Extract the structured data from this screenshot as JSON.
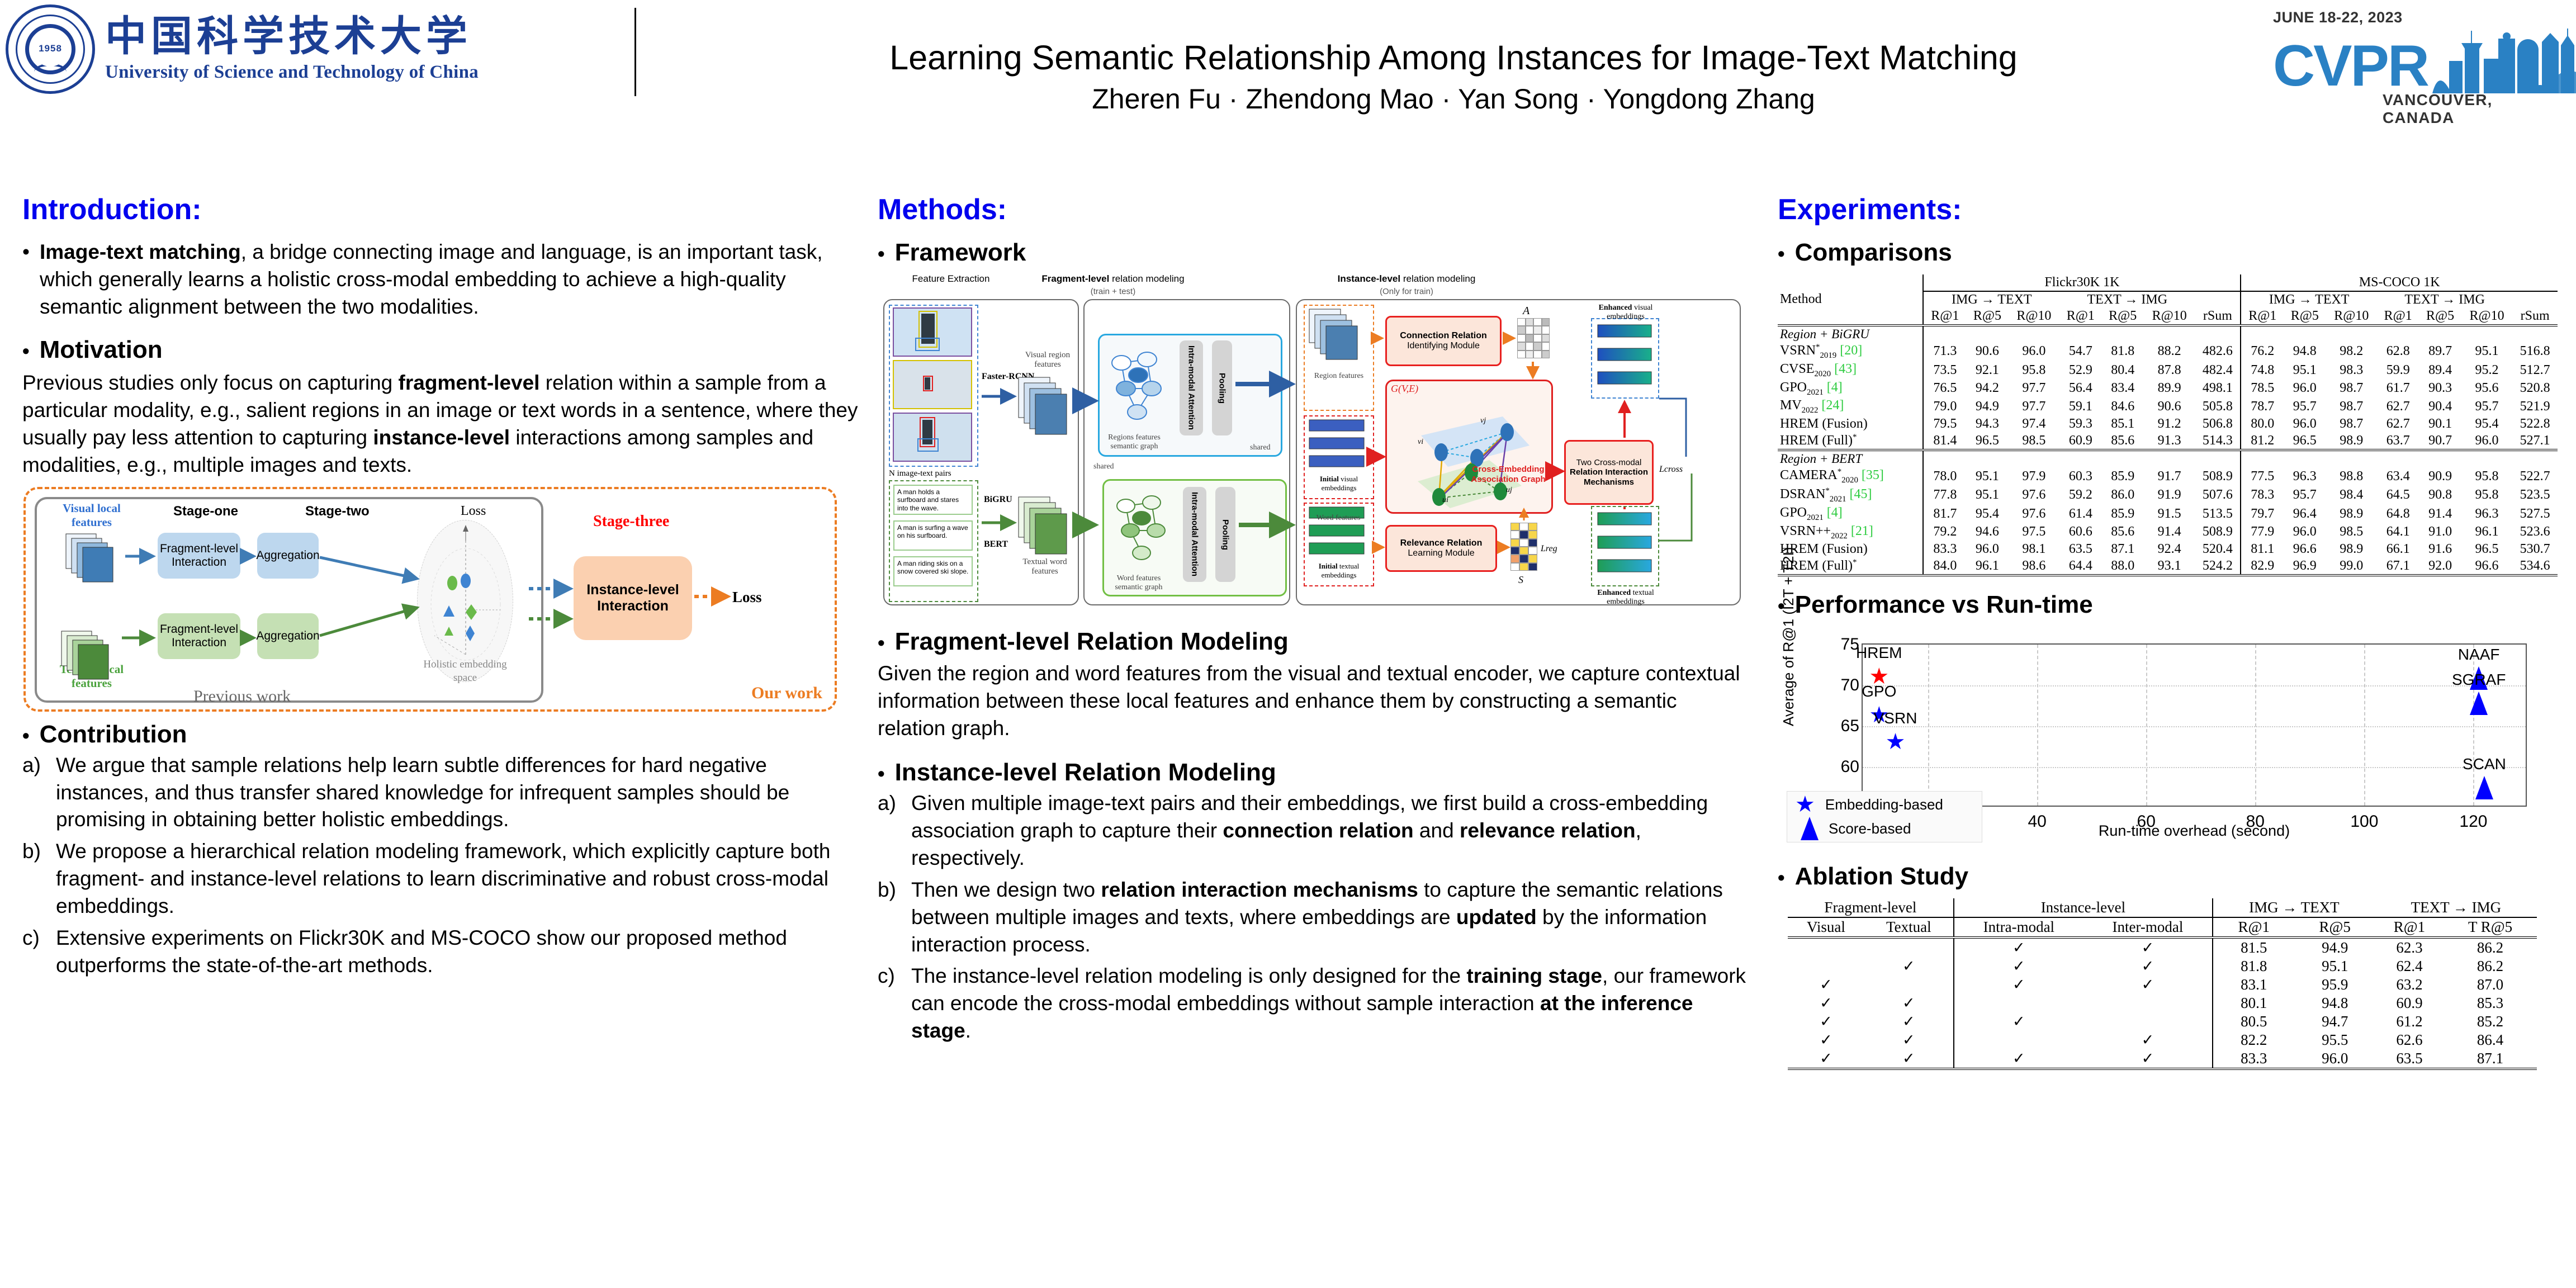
{
  "header": {
    "university_cn": "中国科学技术大学",
    "university_en": "University of Science and Technology of China",
    "seal_year": "1958",
    "paper_title": "Learning Semantic Relationship Among Instances for Image-Text Matching",
    "authors": "Zheren Fu · Zhendong Mao · Yan Song · Yongdong Zhang",
    "conference_date": "JUNE 18-22, 2023",
    "conference_name": "CVPR",
    "conference_location": "VANCOUVER, CANADA"
  },
  "intro": {
    "heading": "Introduction:",
    "b1_lead": "Image-text matching",
    "b1_rest": ", a bridge connecting image and language, is an important task, which generally learns a holistic cross-modal embedding to achieve a high-quality semantic alignment between the two modalities.",
    "motivation_heading": "Motivation",
    "motivation_p1": "Previous studies only focus on capturing ",
    "motivation_b1": "fragment-level",
    "motivation_p2": " relation within a sample from a particular modality, e.g., salient regions in an image or text words in a sentence, where they usually pay less attention to capturing ",
    "motivation_b2": "instance-level",
    "motivation_p3": " interactions among samples and modalities, e.g., multiple images and texts.",
    "figure": {
      "visual_local_features": "Visual local features",
      "textual_local_features": "Textual local features",
      "stage_one": "Stage-one",
      "stage_two": "Stage-two",
      "stage_three": "Stage-three",
      "loss": "Loss",
      "fragment_interaction": "Fragment-level Interaction",
      "aggregation": "Aggregation",
      "holistic_space": "Holistic embedding  space",
      "instance_interaction": "Instance-level Interaction",
      "loss_right": "Loss",
      "previous_work": "Previous work",
      "our_work": "Our work"
    },
    "contribution_heading": "Contribution",
    "contributions": [
      {
        "mark": "a)",
        "text": "We argue that sample relations help learn subtle differences for hard negative instances, and thus transfer shared knowledge for infrequent samples should be promising in obtaining better holistic embeddings."
      },
      {
        "mark": "b)",
        "text": "We propose a hierarchical relation modeling framework, which explicitly capture both fragment- and instance-level relations to learn discriminative and robust cross-modal embeddings."
      },
      {
        "mark": "c)",
        "text": "Extensive experiments on Flickr30K and MS-COCO show our proposed method outperforms the state-of-the-art methods."
      }
    ]
  },
  "methods": {
    "heading": "Methods:",
    "framework_heading": "Framework",
    "figure": {
      "feature_extraction": "Feature Extraction",
      "fragment_modeling_bold": "Fragment-level",
      "fragment_modeling_rest": " relation modeling",
      "fragment_modeling_sub": "(train + test)",
      "instance_modeling_bold": "Instance-level",
      "instance_modeling_rest": " relation modeling",
      "instance_modeling_sub": "(Only for train)",
      "faster_rcnn": "Faster-RCNN",
      "visual_region_features": "Visual region features",
      "n_pairs": "N image-text pairs",
      "bigru": "BiGRU",
      "bert": "BERT",
      "textual_word_features": "Textual word features",
      "sentences": [
        "A man holds a surfboard and stares into the wave.",
        "A man is surfing a wave on his surfboard.",
        "A man riding skis on a snow covered ski slope."
      ],
      "regions_graph": "Regions features semantic graph",
      "words_graph": "Word features semantic graph",
      "intra_modal_attention": "Intra-modal Attention",
      "pooling": "Pooling",
      "shared": "shared",
      "region_features": "Region features",
      "word_features": "Word features",
      "initial_visual": "Initial visual embeddings",
      "initial_textual": "Initial textual embeddings",
      "connection_relation_bold": "Connection Relation",
      "connection_relation_rest": "Identifying Module",
      "relevance_relation_bold": "Relevance Relation",
      "relevance_relation_rest": "Learning Module",
      "graph_symbol": "G(V,E)",
      "cross_embedding_graph": "Cross-Embedding Association Graph",
      "two_cross_modal": "Two Cross-modal",
      "relation_interaction": "Relation Interaction",
      "mechanisms": "Mechanisms",
      "matrix_a": "A",
      "matrix_s": "S",
      "loss_cross": "Lcross",
      "loss_reg": "Lreg",
      "enhanced_visual": "Enhanced visual embeddings",
      "enhanced_textual": "Enhanced textual embeddings",
      "node_vi": "vi",
      "node_vj": "vj",
      "node_ui": "ui",
      "node_uj": "uj"
    },
    "fragment_heading": "Fragment-level Relation Modeling",
    "fragment_text": "Given the region and word features from the visual and textual encoder, we capture contextual information between these local features and enhance them by constructing a semantic relation graph.",
    "instance_heading": "Instance-level Relation Modeling",
    "instance_items": [
      {
        "mark": "a)",
        "pre": "Given multiple image-text pairs and their embeddings, we first build a cross-embedding association graph to capture their ",
        "b1": "connection relation",
        "mid": " and ",
        "b2": "relevance relation",
        "post": ", respectively."
      },
      {
        "mark": "b)",
        "pre": "Then we design two ",
        "b1": "relation interaction mechanisms",
        "mid": " to capture the semantic relations between multiple images and texts, where embeddings are ",
        "b2": "updated",
        "post": " by the information interaction process."
      },
      {
        "mark": "c)",
        "pre": "The instance-level relation modeling is only designed for the ",
        "b1": "training stage",
        "mid": ", our framework can encode the cross-modal embeddings without sample interaction ",
        "b2": "at the inference stage",
        "post": "."
      }
    ]
  },
  "experiments": {
    "heading": "Experiments:",
    "comparisons_heading": "Comparisons",
    "comparison_table": {
      "col_method": "Method",
      "dataset_groups": [
        "Flickr30K 1K",
        "MS-COCO 1K"
      ],
      "direction_headers": [
        "IMG → TEXT",
        "TEXT → IMG",
        "rSum"
      ],
      "metric_headers": [
        "R@1",
        "R@5",
        "R@10",
        "R@1",
        "R@5",
        "R@10"
      ],
      "sections": [
        {
          "title": "Region + BiGRU",
          "rows": [
            {
              "method": "VSRN",
              "sub": "2019",
              "sup": "*",
              "ref": "[20]",
              "bold": false,
              "vals": [
                "71.3",
                "90.6",
                "96.0",
                "54.7",
                "81.8",
                "88.2",
                "482.6",
                "76.2",
                "94.8",
                "98.2",
                "62.8",
                "89.7",
                "95.1",
                "516.8"
              ]
            },
            {
              "method": "CVSE",
              "sub": "2020",
              "sup": "",
              "ref": "[43]",
              "bold": false,
              "vals": [
                "73.5",
                "92.1",
                "95.8",
                "52.9",
                "80.4",
                "87.8",
                "482.4",
                "74.8",
                "95.1",
                "98.3",
                "59.9",
                "89.4",
                "95.2",
                "512.7"
              ]
            },
            {
              "method": "GPO",
              "sub": "2021",
              "sup": "",
              "ref": "[4]",
              "bold": false,
              "vals": [
                "76.5",
                "94.2",
                "97.7",
                "56.4",
                "83.4",
                "89.9",
                "498.1",
                "78.5",
                "96.0",
                "98.7",
                "61.7",
                "90.3",
                "95.6",
                "520.8"
              ]
            },
            {
              "method": "MV",
              "sub": "2022",
              "sup": "",
              "ref": "[24]",
              "bold": false,
              "vals": [
                "79.0",
                "94.9",
                "97.7",
                "59.1",
                "84.6",
                "90.6",
                "505.8",
                "78.7",
                "95.7",
                "98.7",
                "62.7",
                "90.4",
                "95.7",
                "521.9"
              ]
            },
            {
              "method": "HREM (Fusion)",
              "sub": "",
              "sup": "",
              "ref": "",
              "bold": true,
              "vals": [
                "79.5",
                "94.3",
                "97.4",
                "59.3",
                "85.1",
                "91.2",
                "506.8",
                "80.0",
                "96.0",
                "98.7",
                "62.7",
                "90.1",
                "95.4",
                "522.8"
              ]
            },
            {
              "method": "HREM (Full)",
              "sub": "",
              "sup": "*",
              "ref": "",
              "bold": true,
              "vals": [
                "81.4",
                "96.5",
                "98.5",
                "60.9",
                "85.6",
                "91.3",
                "514.3",
                "81.2",
                "96.5",
                "98.9",
                "63.7",
                "90.7",
                "96.0",
                "527.1"
              ]
            }
          ]
        },
        {
          "title": "Region + BERT",
          "rows": [
            {
              "method": "CAMERA",
              "sub": "2020",
              "sup": "*",
              "ref": "[35]",
              "bold": false,
              "vals": [
                "78.0",
                "95.1",
                "97.9",
                "60.3",
                "85.9",
                "91.7",
                "508.9",
                "77.5",
                "96.3",
                "98.8",
                "63.4",
                "90.9",
                "95.8",
                "522.7"
              ]
            },
            {
              "method": "DSRAN",
              "sub": "2021",
              "sup": "*",
              "ref": "[45]",
              "bold": false,
              "vals": [
                "77.8",
                "95.1",
                "97.6",
                "59.2",
                "86.0",
                "91.9",
                "507.6",
                "78.3",
                "95.7",
                "98.4",
                "64.5",
                "90.8",
                "95.8",
                "523.5"
              ]
            },
            {
              "method": "GPO",
              "sub": "2021",
              "sup": "",
              "ref": "[4]",
              "bold": false,
              "vals": [
                "81.7",
                "95.4",
                "97.6",
                "61.4",
                "85.9",
                "91.5",
                "513.5",
                "79.7",
                "96.4",
                "98.9",
                "64.8",
                "91.4",
                "96.3",
                "527.5"
              ]
            },
            {
              "method": "VSRN++",
              "sub": "2022",
              "sup": "",
              "ref": "[21]",
              "bold": false,
              "vals": [
                "79.2",
                "94.6",
                "97.5",
                "60.6",
                "85.6",
                "91.4",
                "508.9",
                "77.9",
                "96.0",
                "98.5",
                "64.1",
                "91.0",
                "96.1",
                "523.6"
              ]
            },
            {
              "method": "HREM (Fusion)",
              "sub": "",
              "sup": "",
              "ref": "",
              "bold": true,
              "vals": [
                "83.3",
                "96.0",
                "98.1",
                "63.5",
                "87.1",
                "92.4",
                "520.4",
                "81.1",
                "96.6",
                "98.9",
                "66.1",
                "91.6",
                "96.5",
                "530.7"
              ]
            },
            {
              "method": "HREM (Full)",
              "sub": "",
              "sup": "*",
              "ref": "",
              "bold": true,
              "vals": [
                "84.0",
                "96.1",
                "98.6",
                "64.4",
                "88.0",
                "93.1",
                "524.2",
                "82.9",
                "96.9",
                "99.0",
                "67.1",
                "92.0",
                "96.6",
                "534.6"
              ]
            }
          ]
        }
      ]
    },
    "runtime_heading": "Performance vs Run-time",
    "ablation_heading": "Ablation Study",
    "ablation_table": {
      "group_headers": [
        "Fragment-level",
        "Instance-level",
        "IMG → TEXT",
        "TEXT → IMG"
      ],
      "sub_headers": [
        "Visual",
        "Textual",
        "Intra-modal",
        "Inter-modal",
        "R@1",
        "R@5",
        "R@1",
        "T R@5"
      ],
      "check": "✓",
      "rows": [
        {
          "visual": false,
          "textual": false,
          "intra": true,
          "inter": true,
          "vals": [
            "81.5",
            "94.9",
            "62.3",
            "86.2"
          ]
        },
        {
          "visual": false,
          "textual": true,
          "intra": true,
          "inter": true,
          "vals": [
            "81.8",
            "95.1",
            "62.4",
            "86.2"
          ]
        },
        {
          "visual": true,
          "textual": false,
          "intra": true,
          "inter": true,
          "vals": [
            "83.1",
            "95.9",
            "63.2",
            "87.0"
          ]
        },
        {
          "visual": true,
          "textual": true,
          "intra": false,
          "inter": false,
          "vals": [
            "80.1",
            "94.8",
            "60.9",
            "85.3"
          ]
        },
        {
          "visual": true,
          "textual": true,
          "intra": true,
          "inter": false,
          "vals": [
            "80.5",
            "94.7",
            "61.2",
            "85.2"
          ]
        },
        {
          "visual": true,
          "textual": true,
          "intra": false,
          "inter": true,
          "vals": [
            "82.2",
            "95.5",
            "62.6",
            "86.4"
          ]
        },
        {
          "visual": true,
          "textual": true,
          "intra": true,
          "inter": true,
          "vals": [
            "83.3",
            "96.0",
            "63.5",
            "87.1"
          ]
        }
      ]
    }
  },
  "chart_data": {
    "type": "scatter",
    "title": "Performance vs Run-time",
    "xlabel": "Run-time overhead (second)",
    "ylabel": "Average of R@1 (I2T + T2I)",
    "xlim": [
      8,
      130
    ],
    "ylim": [
      55,
      75
    ],
    "xticks": [
      20,
      40,
      60,
      80,
      100,
      120
    ],
    "yticks": [
      55,
      60,
      65,
      70,
      75
    ],
    "grid": true,
    "legend_position": "bottom-left",
    "legend": [
      {
        "label": "Embedding-based",
        "marker": "star",
        "color": "#0000ff"
      },
      {
        "label": "Score-based",
        "marker": "triangle",
        "color": "#0000ff"
      }
    ],
    "points": [
      {
        "label": "HREM",
        "x": 11,
        "y": 71.1,
        "marker": "star",
        "color": "#ff0000"
      },
      {
        "label": "GPO",
        "x": 11,
        "y": 66.4,
        "marker": "star",
        "color": "#0000ff"
      },
      {
        "label": "VSRN",
        "x": 14,
        "y": 63.1,
        "marker": "star",
        "color": "#0000ff"
      },
      {
        "label": "NAAF",
        "x": 121,
        "y": 70.9,
        "marker": "triangle",
        "color": "#0000ff"
      },
      {
        "label": "SGRAF",
        "x": 121,
        "y": 67.8,
        "marker": "triangle",
        "color": "#0000ff"
      },
      {
        "label": "SCAN",
        "x": 122,
        "y": 57.5,
        "marker": "triangle",
        "color": "#0000ff"
      }
    ]
  }
}
